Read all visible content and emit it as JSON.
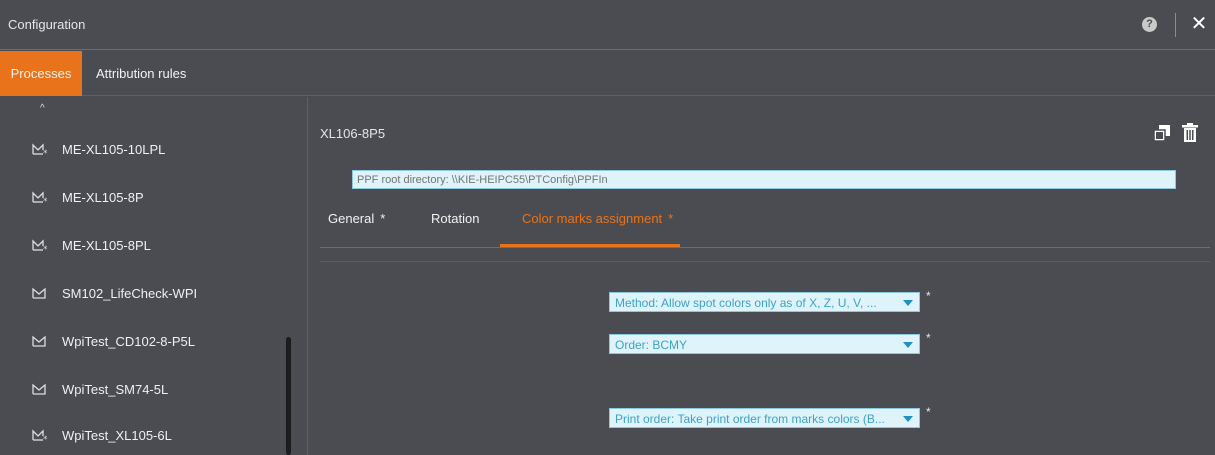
{
  "window": {
    "title": "Configuration"
  },
  "tabs": {
    "processes": "Processes",
    "attribution": "Attribution rules"
  },
  "sidebar": {
    "items": [
      {
        "label": "ME-XL105-10LPL",
        "icon": "process-starred-icon"
      },
      {
        "label": "ME-XL105-8P",
        "icon": "process-starred-icon"
      },
      {
        "label": "ME-XL105-8PL",
        "icon": "process-starred-icon"
      },
      {
        "label": "SM102_LifeCheck-WPI",
        "icon": "process-icon"
      },
      {
        "label": "WpiTest_CD102-8-P5L",
        "icon": "process-icon"
      },
      {
        "label": "WpiTest_SM74-5L",
        "icon": "process-icon"
      },
      {
        "label": "WpiTest_XL105-6L",
        "icon": "process-starred-icon"
      }
    ]
  },
  "main": {
    "process_title": "XL106-8P5",
    "ppf_placeholder": "PPF root directory: \\\\KIE-HEIPC55\\PTConfig\\PPFIn",
    "tabs": [
      {
        "label": "General",
        "star": "*"
      },
      {
        "label": "Rotation",
        "star": ""
      },
      {
        "label": "Color marks assignment",
        "star": "*"
      }
    ],
    "fields": {
      "method": "Method: Allow spot colors only as of X, Z, U, V, ...",
      "order": "Order: BCMY",
      "print_order": "Print order: Take print order from marks colors (B..."
    },
    "required_mark": "*"
  },
  "colors": {
    "accent": "#e8731a",
    "background": "#4a4c52",
    "field_bg": "#dff3fb",
    "field_text": "#3ea2c8"
  }
}
